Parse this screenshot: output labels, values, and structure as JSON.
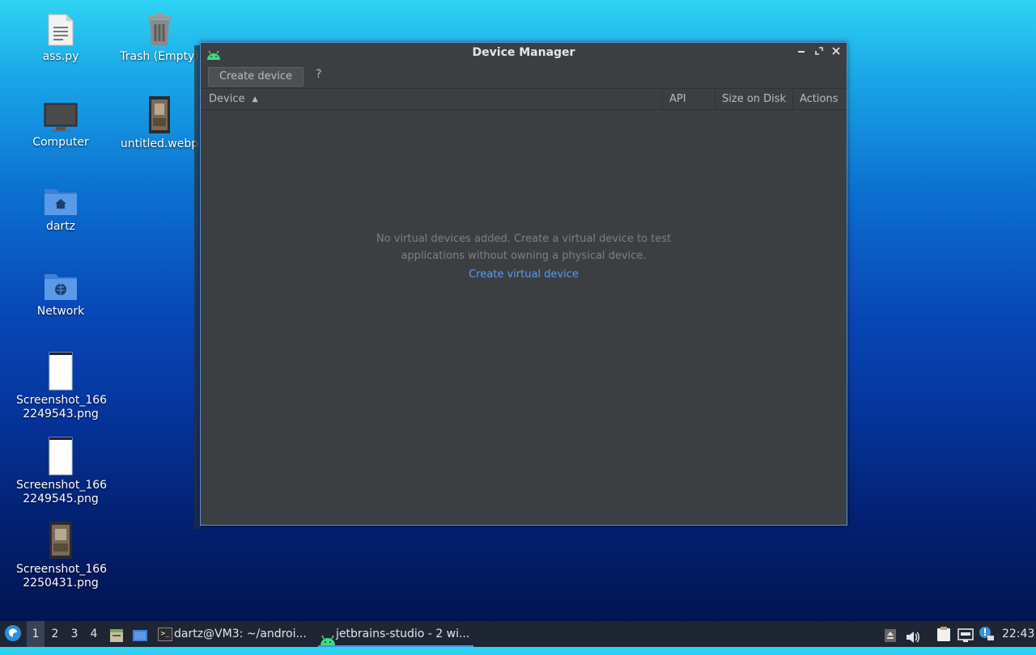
{
  "desktop": {
    "icons": [
      {
        "label": "ass.py"
      },
      {
        "label": "Trash (Empty)"
      },
      {
        "label": "Computer"
      },
      {
        "label": "untitled.webp"
      },
      {
        "label": "dartz"
      },
      {
        "label": "Network"
      },
      {
        "label": "Screenshot_166\n2249543.png"
      },
      {
        "label": "Screenshot_166\n2249545.png"
      },
      {
        "label": "Screenshot_166\n2250431.png"
      }
    ]
  },
  "window": {
    "title": "Device Manager",
    "toolbar": {
      "create_label": "Create device",
      "help_label": "?"
    },
    "columns": {
      "device": "Device",
      "api": "API",
      "size": "Size on Disk",
      "actions": "Actions"
    },
    "sort_indicator": "▲",
    "empty": {
      "line1": "No virtual devices added. Create a virtual device to test",
      "line2": "applications without owning a physical device.",
      "link": "Create virtual device"
    },
    "accent": "#5b8fd8",
    "link_color": "#589df6"
  },
  "taskbar": {
    "workspaces": [
      "1",
      "2",
      "3",
      "4"
    ],
    "tasks": [
      {
        "label": "dartz@VM3: ~/androi..."
      },
      {
        "label": "jetbrains-studio - 2 wi..."
      }
    ],
    "clock": "22:43"
  }
}
